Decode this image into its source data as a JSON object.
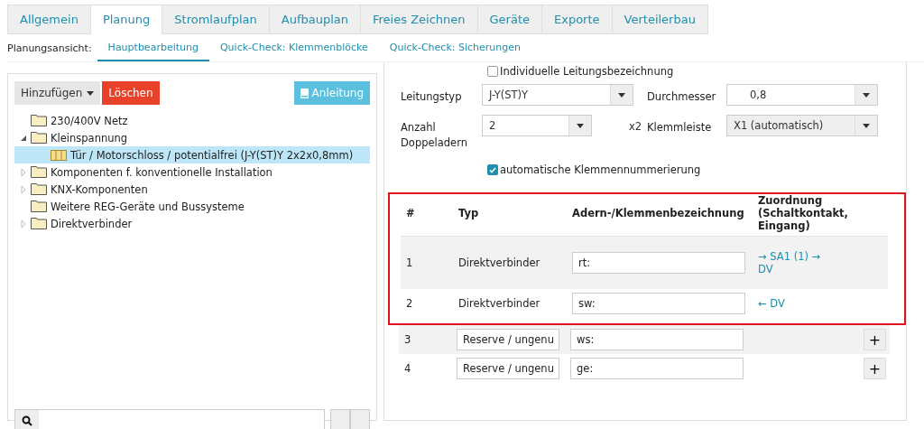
{
  "tabs": [
    {
      "label": "Allgemein",
      "selected": false
    },
    {
      "label": "Planung",
      "selected": true
    },
    {
      "label": "Stromlaufplan",
      "selected": false
    },
    {
      "label": "Aufbauplan",
      "selected": false
    },
    {
      "label": "Freies Zeichnen",
      "selected": false
    },
    {
      "label": "Geräte",
      "selected": false
    },
    {
      "label": "Exporte",
      "selected": false
    },
    {
      "label": "Verteilerbau",
      "selected": false
    }
  ],
  "subnav": {
    "label": "Planungsansicht:",
    "items": [
      {
        "label": "Hauptbearbeitung",
        "selected": true
      },
      {
        "label": "Quick-Check: Klemmenblöcke",
        "selected": false
      },
      {
        "label": "Quick-Check: Sicherungen",
        "selected": false
      }
    ]
  },
  "toolbar": {
    "add_button": "Hinzufügen",
    "delete_button": "Löschen",
    "guide_button": "Anleitung"
  },
  "tree": [
    {
      "label": "230/400V Netz",
      "kind": "folder",
      "selected": false
    },
    {
      "label": "Kleinspannung",
      "kind": "folder",
      "expanded": true,
      "selected": false,
      "children": [
        {
          "label": "Tür / Motorschloss / potentialfrei (J-Y(ST)Y 2x2x0,8mm)",
          "kind": "cable",
          "selected": true
        }
      ]
    },
    {
      "label": "Komponenten f. konventionelle Installation",
      "kind": "folder",
      "expanded": false,
      "selected": false
    },
    {
      "label": "KNX-Komponenten",
      "kind": "folder",
      "expanded": false,
      "selected": false
    },
    {
      "label": "Weitere REG-Geräte und Bussysteme",
      "kind": "folder",
      "selected": false
    },
    {
      "label": "Direktverbinder",
      "kind": "folder",
      "expanded": false,
      "selected": false
    }
  ],
  "form": {
    "custom_name": {
      "label": "Individuelle Leitungsbezeichnung",
      "checked": false
    },
    "cable_type": {
      "label": "Leitungstyp",
      "value": "J-Y(ST)Y",
      "disabled": false
    },
    "diameter": {
      "label": "Durchmesser",
      "value": "0,8",
      "disabled": false
    },
    "pairs": {
      "label": "Anzahl Doppeladern",
      "value": "2",
      "suffix": "x2",
      "disabled": false
    },
    "terminal_strip": {
      "label": "Klemmleiste",
      "value": "X1 (automatisch)",
      "disabled": true
    },
    "auto_numbering": {
      "label": "automatische Klemmennummerierung",
      "checked": true
    }
  },
  "table": {
    "columns": [
      "#",
      "Typ",
      "Adern-/Klemmenbezeichnung",
      "Zuordnung (Schaltkontakt, Eingang)"
    ],
    "rows": [
      {
        "number": "1",
        "kind": "fixed",
        "type": "Direktverbinder",
        "designation": "rt:",
        "assignment": "→ SA1 (1) → DV",
        "highlighted": true
      },
      {
        "number": "2",
        "kind": "fixed",
        "type": "Direktverbinder",
        "designation": "sw:",
        "assignment": "← DV",
        "highlighted": true
      },
      {
        "number": "3",
        "kind": "reserve",
        "type": "Reserve / ungenu",
        "designation": "ws:",
        "add": "+",
        "highlighted": false
      },
      {
        "number": "4",
        "kind": "reserve",
        "type": "Reserve / ungenu",
        "designation": "ge:",
        "add": "+",
        "highlighted": false
      }
    ]
  }
}
